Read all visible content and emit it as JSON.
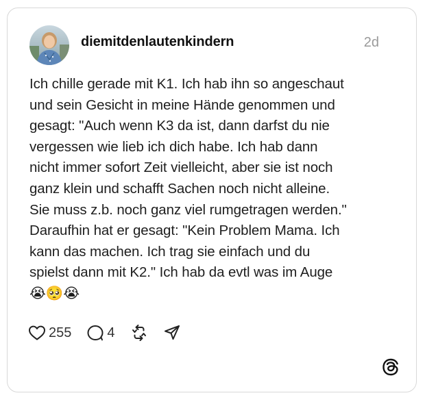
{
  "post": {
    "username": "diemitdenlautenkindern",
    "timestamp": "2d",
    "text": "Ich chille gerade mit K1. Ich hab ihn so angeschaut\nund sein Gesicht in meine Hände genommen und\ngesagt: \"Auch wenn K3 da ist, dann darfst du nie\nvergessen wie lieb ich dich habe. Ich hab dann\nnicht immer sofort Zeit vielleicht, aber sie ist noch\nganz klein und schafft Sachen noch nicht alleine.\nSie muss z.b. noch ganz viel rumgetragen werden.\"\nDaraufhin hat er gesagt: \"Kein Problem Mama. Ich\nkann das machen. Ich trag sie einfach und du\nspielst dann mit K2.\" Ich hab da evtl was im Auge\n😭🥺😭"
  },
  "actions": {
    "like_count": "255",
    "reply_count": "4",
    "icons": [
      "heart-icon",
      "comment-icon",
      "repost-icon",
      "share-icon"
    ]
  },
  "branding": {
    "logo_icon": "threads-logo-icon"
  },
  "colors": {
    "border": "#d8d8d8",
    "text": "#1e1e1e",
    "timestamp": "#9a9a9a"
  }
}
